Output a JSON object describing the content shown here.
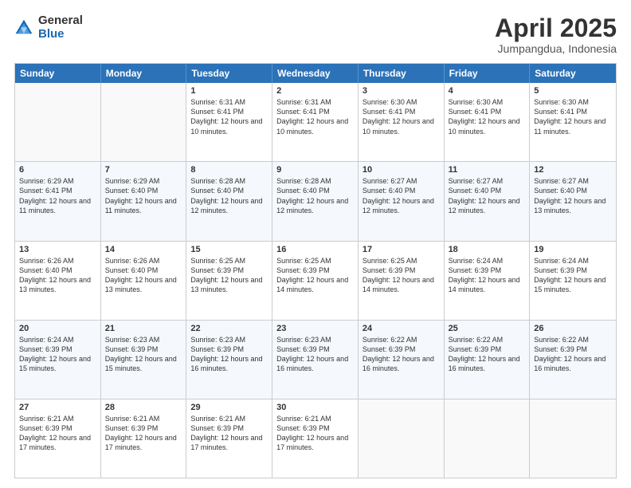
{
  "logo": {
    "general": "General",
    "blue": "Blue"
  },
  "header": {
    "month": "April 2025",
    "location": "Jumpangdua, Indonesia"
  },
  "weekdays": [
    "Sunday",
    "Monday",
    "Tuesday",
    "Wednesday",
    "Thursday",
    "Friday",
    "Saturday"
  ],
  "rows": [
    [
      {
        "day": "",
        "sunrise": "",
        "sunset": "",
        "daylight": ""
      },
      {
        "day": "",
        "sunrise": "",
        "sunset": "",
        "daylight": ""
      },
      {
        "day": "1",
        "sunrise": "Sunrise: 6:31 AM",
        "sunset": "Sunset: 6:41 PM",
        "daylight": "Daylight: 12 hours and 10 minutes."
      },
      {
        "day": "2",
        "sunrise": "Sunrise: 6:31 AM",
        "sunset": "Sunset: 6:41 PM",
        "daylight": "Daylight: 12 hours and 10 minutes."
      },
      {
        "day": "3",
        "sunrise": "Sunrise: 6:30 AM",
        "sunset": "Sunset: 6:41 PM",
        "daylight": "Daylight: 12 hours and 10 minutes."
      },
      {
        "day": "4",
        "sunrise": "Sunrise: 6:30 AM",
        "sunset": "Sunset: 6:41 PM",
        "daylight": "Daylight: 12 hours and 10 minutes."
      },
      {
        "day": "5",
        "sunrise": "Sunrise: 6:30 AM",
        "sunset": "Sunset: 6:41 PM",
        "daylight": "Daylight: 12 hours and 11 minutes."
      }
    ],
    [
      {
        "day": "6",
        "sunrise": "Sunrise: 6:29 AM",
        "sunset": "Sunset: 6:41 PM",
        "daylight": "Daylight: 12 hours and 11 minutes."
      },
      {
        "day": "7",
        "sunrise": "Sunrise: 6:29 AM",
        "sunset": "Sunset: 6:40 PM",
        "daylight": "Daylight: 12 hours and 11 minutes."
      },
      {
        "day": "8",
        "sunrise": "Sunrise: 6:28 AM",
        "sunset": "Sunset: 6:40 PM",
        "daylight": "Daylight: 12 hours and 12 minutes."
      },
      {
        "day": "9",
        "sunrise": "Sunrise: 6:28 AM",
        "sunset": "Sunset: 6:40 PM",
        "daylight": "Daylight: 12 hours and 12 minutes."
      },
      {
        "day": "10",
        "sunrise": "Sunrise: 6:27 AM",
        "sunset": "Sunset: 6:40 PM",
        "daylight": "Daylight: 12 hours and 12 minutes."
      },
      {
        "day": "11",
        "sunrise": "Sunrise: 6:27 AM",
        "sunset": "Sunset: 6:40 PM",
        "daylight": "Daylight: 12 hours and 12 minutes."
      },
      {
        "day": "12",
        "sunrise": "Sunrise: 6:27 AM",
        "sunset": "Sunset: 6:40 PM",
        "daylight": "Daylight: 12 hours and 13 minutes."
      }
    ],
    [
      {
        "day": "13",
        "sunrise": "Sunrise: 6:26 AM",
        "sunset": "Sunset: 6:40 PM",
        "daylight": "Daylight: 12 hours and 13 minutes."
      },
      {
        "day": "14",
        "sunrise": "Sunrise: 6:26 AM",
        "sunset": "Sunset: 6:40 PM",
        "daylight": "Daylight: 12 hours and 13 minutes."
      },
      {
        "day": "15",
        "sunrise": "Sunrise: 6:25 AM",
        "sunset": "Sunset: 6:39 PM",
        "daylight": "Daylight: 12 hours and 13 minutes."
      },
      {
        "day": "16",
        "sunrise": "Sunrise: 6:25 AM",
        "sunset": "Sunset: 6:39 PM",
        "daylight": "Daylight: 12 hours and 14 minutes."
      },
      {
        "day": "17",
        "sunrise": "Sunrise: 6:25 AM",
        "sunset": "Sunset: 6:39 PM",
        "daylight": "Daylight: 12 hours and 14 minutes."
      },
      {
        "day": "18",
        "sunrise": "Sunrise: 6:24 AM",
        "sunset": "Sunset: 6:39 PM",
        "daylight": "Daylight: 12 hours and 14 minutes."
      },
      {
        "day": "19",
        "sunrise": "Sunrise: 6:24 AM",
        "sunset": "Sunset: 6:39 PM",
        "daylight": "Daylight: 12 hours and 15 minutes."
      }
    ],
    [
      {
        "day": "20",
        "sunrise": "Sunrise: 6:24 AM",
        "sunset": "Sunset: 6:39 PM",
        "daylight": "Daylight: 12 hours and 15 minutes."
      },
      {
        "day": "21",
        "sunrise": "Sunrise: 6:23 AM",
        "sunset": "Sunset: 6:39 PM",
        "daylight": "Daylight: 12 hours and 15 minutes."
      },
      {
        "day": "22",
        "sunrise": "Sunrise: 6:23 AM",
        "sunset": "Sunset: 6:39 PM",
        "daylight": "Daylight: 12 hours and 16 minutes."
      },
      {
        "day": "23",
        "sunrise": "Sunrise: 6:23 AM",
        "sunset": "Sunset: 6:39 PM",
        "daylight": "Daylight: 12 hours and 16 minutes."
      },
      {
        "day": "24",
        "sunrise": "Sunrise: 6:22 AM",
        "sunset": "Sunset: 6:39 PM",
        "daylight": "Daylight: 12 hours and 16 minutes."
      },
      {
        "day": "25",
        "sunrise": "Sunrise: 6:22 AM",
        "sunset": "Sunset: 6:39 PM",
        "daylight": "Daylight: 12 hours and 16 minutes."
      },
      {
        "day": "26",
        "sunrise": "Sunrise: 6:22 AM",
        "sunset": "Sunset: 6:39 PM",
        "daylight": "Daylight: 12 hours and 16 minutes."
      }
    ],
    [
      {
        "day": "27",
        "sunrise": "Sunrise: 6:21 AM",
        "sunset": "Sunset: 6:39 PM",
        "daylight": "Daylight: 12 hours and 17 minutes."
      },
      {
        "day": "28",
        "sunrise": "Sunrise: 6:21 AM",
        "sunset": "Sunset: 6:39 PM",
        "daylight": "Daylight: 12 hours and 17 minutes."
      },
      {
        "day": "29",
        "sunrise": "Sunrise: 6:21 AM",
        "sunset": "Sunset: 6:39 PM",
        "daylight": "Daylight: 12 hours and 17 minutes."
      },
      {
        "day": "30",
        "sunrise": "Sunrise: 6:21 AM",
        "sunset": "Sunset: 6:39 PM",
        "daylight": "Daylight: 12 hours and 17 minutes."
      },
      {
        "day": "",
        "sunrise": "",
        "sunset": "",
        "daylight": ""
      },
      {
        "day": "",
        "sunrise": "",
        "sunset": "",
        "daylight": ""
      },
      {
        "day": "",
        "sunrise": "",
        "sunset": "",
        "daylight": ""
      }
    ]
  ]
}
